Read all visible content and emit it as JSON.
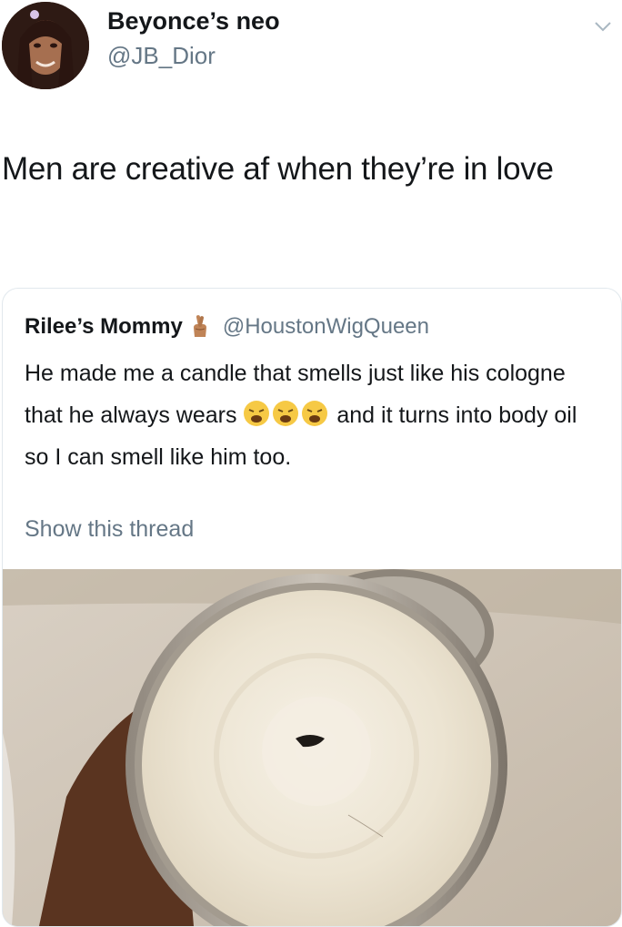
{
  "tweet": {
    "author": {
      "display_name": "Beyonce’s neo",
      "handle": "@JB_Dior"
    },
    "menu_icon": "chevron-down-icon",
    "text": "Men are creative af when they’re in love"
  },
  "quoted_tweet": {
    "author": {
      "display_name": "Rilee’s Mommy",
      "name_emoji": "crossed-fingers-emoji",
      "handle": "@HoustonWigQueen"
    },
    "text_part1": "He made me a candle that smells just like his cologne that he always wears",
    "emojis": [
      "weary-face-emoji",
      "weary-face-emoji",
      "weary-face-emoji"
    ],
    "text_part2": "and it turns into body oil so I can smell like him too.",
    "show_thread_label": "Show this thread"
  },
  "colors": {
    "text_primary": "#14171a",
    "text_secondary": "#657786",
    "border": "#e1e8ed"
  }
}
